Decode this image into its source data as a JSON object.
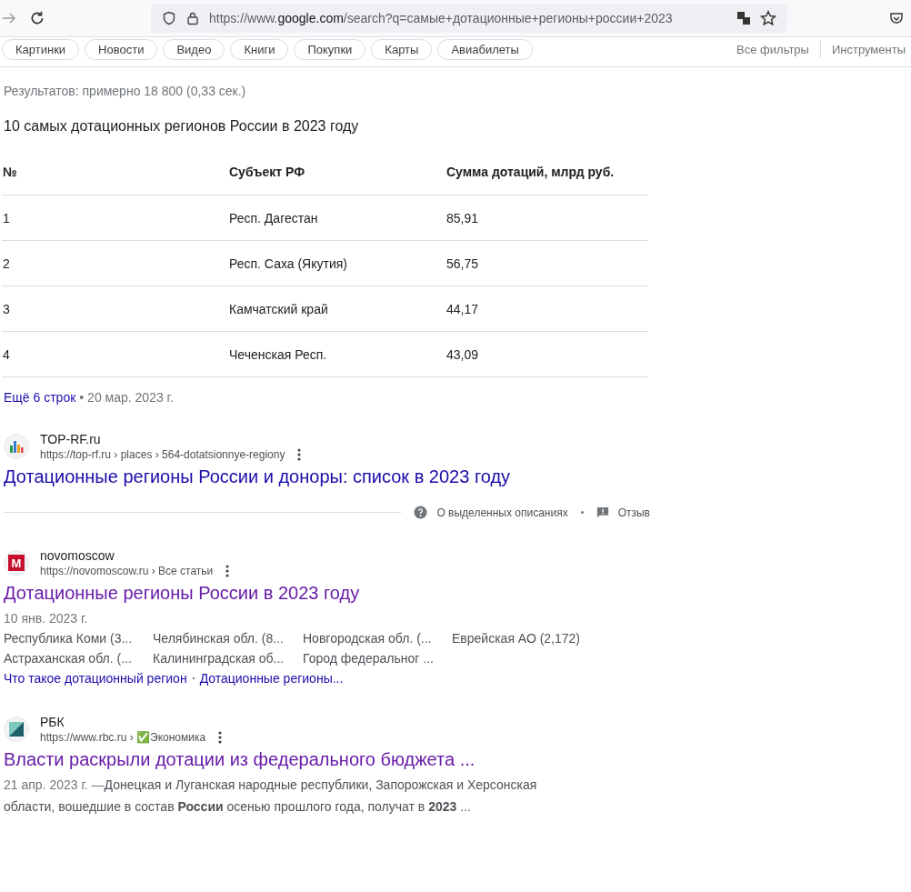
{
  "browser": {
    "url_prefix": "https://www.",
    "url_domain": "google.com",
    "url_rest": "/search?q=самые+дотационные+регионы+россии+2023"
  },
  "filters": {
    "chips": [
      "Картинки",
      "Новости",
      "Видео",
      "Книги",
      "Покупки",
      "Карты",
      "Авиабилеты"
    ],
    "all_filters": "Все фильтры",
    "tools": "Инструменты"
  },
  "result_stats": "Результатов: примерно 18 800 (0,33 сек.)",
  "featured": {
    "heading": "10 самых дотационных регионов России в 2023 году",
    "columns": [
      "№",
      "Субъект РФ",
      "Сумма дотаций, млрд руб."
    ],
    "rows": [
      [
        "1",
        "Респ. Дагестан",
        "85,91"
      ],
      [
        "2",
        "Респ. Саха (Якутия)",
        "56,75"
      ],
      [
        "3",
        "Камчатский край",
        "44,17"
      ],
      [
        "4",
        "Чеченская Респ.",
        "43,09"
      ]
    ],
    "more_rows": "Ещё 6 строк",
    "date": "• 20 мар. 2023 г.",
    "source": {
      "site": "TOP-RF.ru",
      "url": "https://top-rf.ru › places › 564-dotatsionnye-regiony",
      "title": "Дотационные регионы России и доноры: список в 2023 году",
      "visited": false,
      "favicon": {
        "kind": "bars"
      }
    },
    "about": "О выделенных описаниях",
    "feedback": "Отзыв"
  },
  "results": [
    {
      "site": "novomoscow",
      "url": "https://novomoscow.ru › Все статьи",
      "favicon": {
        "kind": "letter",
        "letter": "M"
      },
      "title": "Дотационные регионы России в 2023 году",
      "visited": true,
      "date": "10 янв. 2023 г.",
      "items": [
        "Республика Коми (3...",
        "Челябинская обл. (8...",
        "Новгородская обл. (...",
        "Еврейская АО (2,172)",
        "Астраханская обл. (...",
        "Калининградская об...",
        "Город федеральног ..."
      ],
      "links": [
        "Что такое дотационный регион",
        "Дотационные регионы..."
      ]
    },
    {
      "site": "РБК",
      "url": "https://www.rbc.ru › ✅Экономика",
      "favicon": {
        "kind": "triangle"
      },
      "title": "Власти раскрыли дотации из федерального бюджета ...",
      "visited": true,
      "date": "21 апр. 2023 г. —",
      "snippet": "Донецкая и Луганская народные республики, Запорожская и Херсонская области, вошедшие в состав **России** осенью прошлого года, получат в **2023** ..."
    }
  ]
}
